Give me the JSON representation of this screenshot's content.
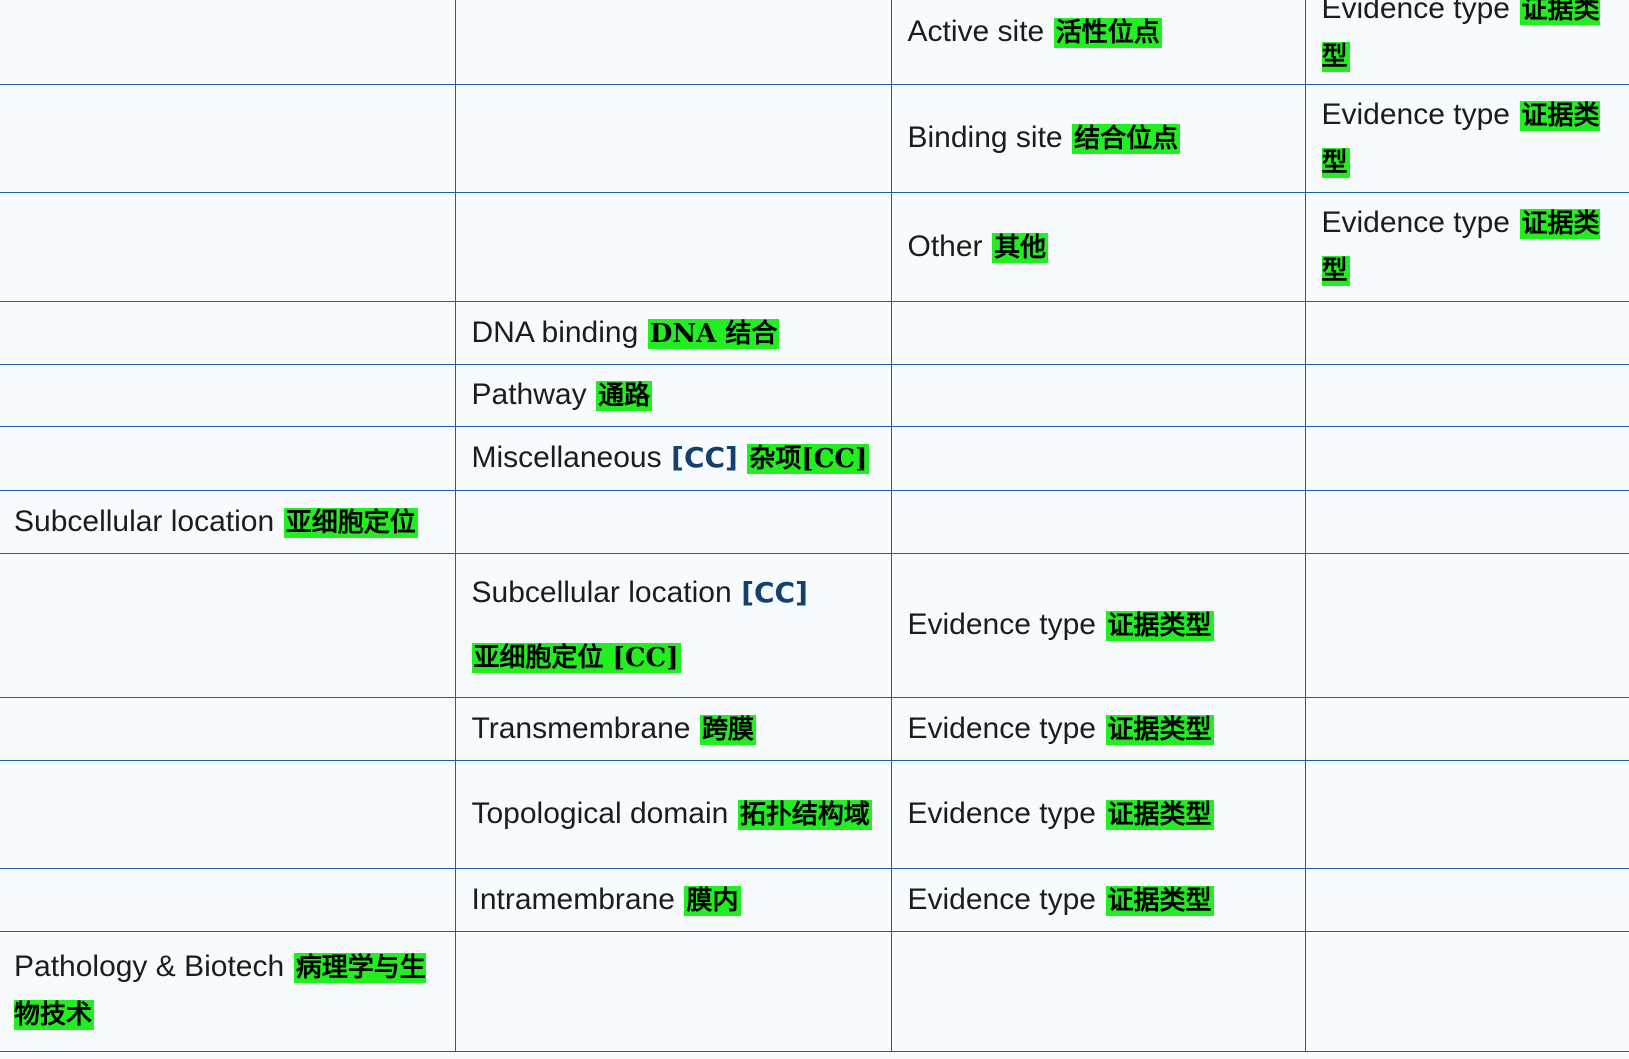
{
  "rows": [
    {
      "c1": null,
      "c2": null,
      "c3": {
        "en": "Active site",
        "zh": "活性位点"
      },
      "c4": {
        "en": "Evidence type",
        "zh": "证据类型"
      }
    },
    {
      "c1": null,
      "c2": null,
      "c3": {
        "en": "Binding site",
        "zh": "结合位点"
      },
      "c4": {
        "en": "Evidence type",
        "zh": "证据类型"
      }
    },
    {
      "c1": null,
      "c2": null,
      "c3": {
        "en": "Other",
        "zh": "其他"
      },
      "c4": {
        "en": "Evidence type",
        "zh": "证据类型"
      }
    },
    {
      "c1": null,
      "c2": {
        "en": "DNA binding",
        "zh": "DNA 结合"
      },
      "c3": null,
      "c4": null
    },
    {
      "c1": null,
      "c2": {
        "en": "Pathway",
        "zh": "通路"
      },
      "c3": null,
      "c4": null
    },
    {
      "c1": null,
      "c2": {
        "en": "Miscellaneous",
        "tag": "[CC]",
        "zh": "杂项[CC]"
      },
      "c3": null,
      "c4": null
    },
    {
      "c1": {
        "en": "Subcellular location",
        "zh": "亚细胞定位"
      },
      "c2": null,
      "c3": null,
      "c4": null
    },
    {
      "c1": null,
      "c2": {
        "en": "Subcellular location",
        "tag": "[CC]",
        "zh": "亚细胞定位 [CC]"
      },
      "c3": {
        "en": "Evidence type",
        "zh": "证据类型"
      },
      "c4": null
    },
    {
      "c1": null,
      "c2": {
        "en": "Transmembrane",
        "zh": "跨膜"
      },
      "c3": {
        "en": "Evidence type",
        "zh": "证据类型"
      },
      "c4": null
    },
    {
      "c1": null,
      "c2": {
        "en": "Topological domain",
        "zh": "拓扑结构域"
      },
      "c3": {
        "en": "Evidence type",
        "zh": "证据类型"
      },
      "c4": null
    },
    {
      "c1": null,
      "c2": {
        "en": "Intramembrane",
        "zh": "膜内"
      },
      "c3": {
        "en": "Evidence type",
        "zh": "证据类型"
      },
      "c4": null
    },
    {
      "c1": {
        "en": "Pathology & Biotech",
        "zh": "病理学与生物技术"
      },
      "c2": null,
      "c3": null,
      "c4": null
    }
  ]
}
